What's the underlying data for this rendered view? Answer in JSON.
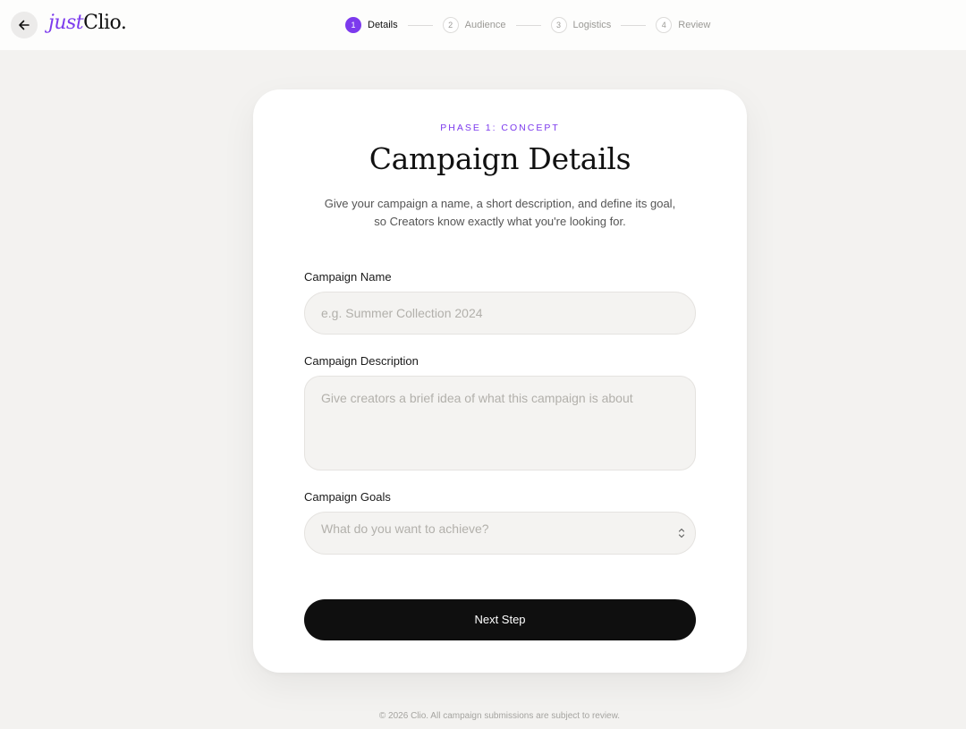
{
  "brand": {
    "prefix": "just",
    "name": "Clio."
  },
  "steps": [
    {
      "num": "1",
      "label": "Details",
      "active": true
    },
    {
      "num": "2",
      "label": "Audience",
      "active": false
    },
    {
      "num": "3",
      "label": "Logistics",
      "active": false
    },
    {
      "num": "4",
      "label": "Review",
      "active": false
    }
  ],
  "card": {
    "phase": "PHASE 1: CONCEPT",
    "title": "Campaign Details",
    "subtitle_line1": "Give your campaign a name, a short description, and define its goal,",
    "subtitle_line2": "so Creators know exactly what you're looking for."
  },
  "form": {
    "name_label": "Campaign Name",
    "name_placeholder": "e.g. Summer Collection 2024",
    "description_label": "Campaign Description",
    "description_placeholder": "Give creators a brief idea of what this campaign is about",
    "goals_label": "Campaign Goals",
    "goals_placeholder": "What do you want to achieve?",
    "next_label": "Next Step"
  },
  "footer": "© 2026 Clio. All campaign submissions are subject to review.",
  "colors": {
    "accent": "#7c3aed",
    "button": "#0f0f0f",
    "background": "#f3f2f0"
  },
  "icons": {
    "back": "arrow-left-icon",
    "select": "chevron-up-down-icon"
  }
}
